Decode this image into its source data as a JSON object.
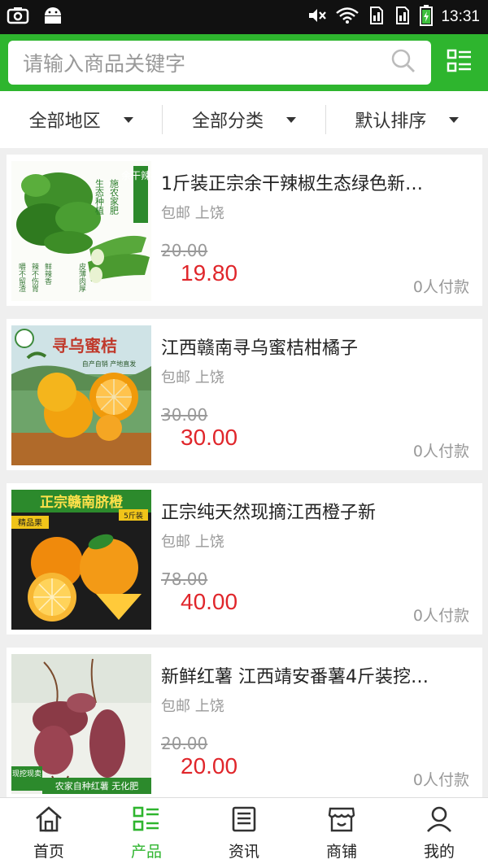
{
  "status": {
    "time": "13:31"
  },
  "search": {
    "placeholder": "请输入商品关键字"
  },
  "filters": [
    {
      "label": "全部地区"
    },
    {
      "label": "全部分类"
    },
    {
      "label": "默认排序"
    }
  ],
  "products": [
    {
      "title": "1斤装正宗余干辣椒生态绿色新…",
      "shipping": "包邮",
      "location": "上饶",
      "old_price": "20.00",
      "price": "19.80",
      "sold": "0人付款"
    },
    {
      "title": "江西赣南寻乌蜜桔柑橘子",
      "shipping": "包邮",
      "location": "上饶",
      "old_price": "30.00",
      "price": "30.00",
      "sold": "0人付款"
    },
    {
      "title": "正宗纯天然现摘江西橙子新",
      "shipping": "包邮",
      "location": "上饶",
      "old_price": "78.00",
      "price": "40.00",
      "sold": "0人付款"
    },
    {
      "title": "新鲜红薯 江西靖安番薯4斤装挖…",
      "shipping": "包邮",
      "location": "上饶",
      "old_price": "20.00",
      "price": "20.00",
      "sold": "0人付款"
    }
  ],
  "thumb_text": {
    "p1": {
      "col1": "生态种植",
      "col2": "施农家肥",
      "col3": "余干辣椒",
      "notes": [
        "嚼不留渣",
        "辣不伤胃",
        "鲜辣香",
        "皮薄肉厚"
      ]
    },
    "p2": {
      "title": "寻乌蜜桔",
      "subtitle": "自产自销 产地直发"
    },
    "p3": {
      "title": "正宗赣南脐橙",
      "tag": "精品果",
      "weight": "5斤装"
    },
    "p4": {
      "badge": "现挖现卖",
      "banner": "农家自种红薯 无化肥"
    }
  },
  "nav": [
    {
      "label": "首页",
      "icon": "home-icon"
    },
    {
      "label": "产品",
      "icon": "grid-icon",
      "active": true
    },
    {
      "label": "资讯",
      "icon": "news-icon"
    },
    {
      "label": "商铺",
      "icon": "store-icon"
    },
    {
      "label": "我的",
      "icon": "user-icon"
    }
  ],
  "colors": {
    "brand_green": "#2eb52e",
    "price_red": "#e0262b"
  }
}
